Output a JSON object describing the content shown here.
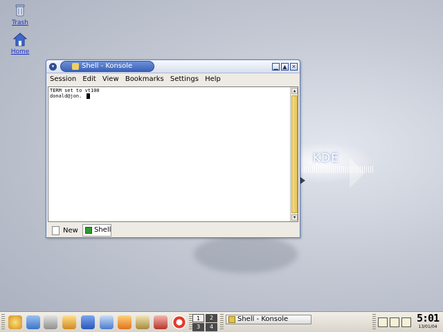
{
  "desktop": {
    "icons": [
      {
        "label": "Trash",
        "icon": "trash-icon"
      },
      {
        "label": "Home",
        "icon": "home-icon"
      }
    ],
    "wallpaper_text": "KDE"
  },
  "window": {
    "title": "Shell - Konsole",
    "menu": [
      "Session",
      "Edit",
      "View",
      "Bookmarks",
      "Settings",
      "Help"
    ],
    "terminal_lines": [
      "TERM set to vt100",
      "donald@jon. "
    ],
    "tabs": {
      "new_label": "New",
      "active_tab_label": "Shell"
    }
  },
  "taskbar": {
    "pager": [
      "1",
      "2",
      "3",
      "4"
    ],
    "active_desktop": "1",
    "task_label": "Shell - Konsole",
    "clock_time": "5:01",
    "clock_date": "13/01/04"
  },
  "colors": {
    "titlebar_accent": "#3e63b8",
    "scrollbar_thumb": "#e5c55a",
    "link_blue": "#1a35c8"
  }
}
